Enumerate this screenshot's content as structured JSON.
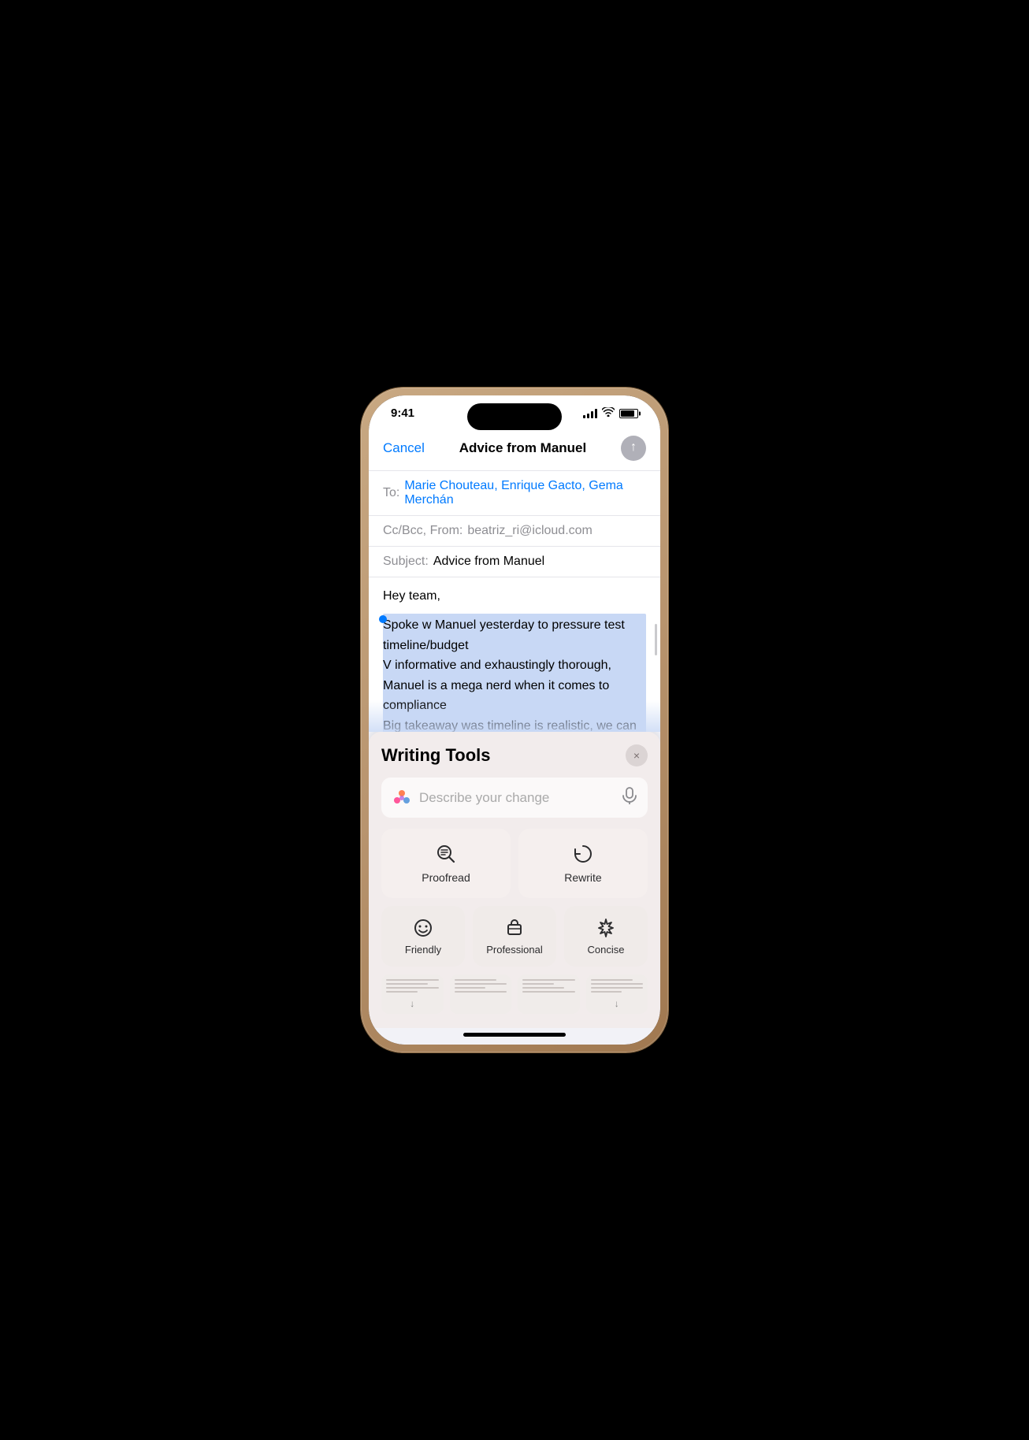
{
  "statusBar": {
    "time": "9:41",
    "batteryLevel": 85
  },
  "navBar": {
    "cancel": "Cancel",
    "title": "Advice from Manuel",
    "sendArrow": "↑"
  },
  "fields": {
    "toLabel": "To:",
    "toValue": "Marie Chouteau, Enrique Gacto, Gema Merchán",
    "ccBccLabel": "Cc/Bcc, From:",
    "ccBccValue": "beatriz_ri@icloud.com",
    "subjectLabel": "Subject:",
    "subjectValue": "Advice from Manuel"
  },
  "emailBody": {
    "greeting": "Hey team,",
    "selectedText": "Spoke w Manuel yesterday to pressure test timeline/budget\nV informative and exhaustingly thorough, Manuel is a mega nerd when it comes to compliance\nBig takeaway was timeline is realistic, we can commit with confidence, woo!\nM's firm specializes in community consultation, we need help here, should consider engaging them for comms/for our stakeholders"
  },
  "writingTools": {
    "title": "Writing Tools",
    "closeLabel": "×",
    "searchPlaceholder": "Describe your change",
    "tools": [
      {
        "id": "proofread",
        "label": "Proofread",
        "iconType": "proofread"
      },
      {
        "id": "rewrite",
        "label": "Rewrite",
        "iconType": "rewrite"
      }
    ],
    "toneTools": [
      {
        "id": "friendly",
        "label": "Friendly",
        "iconType": "smiley"
      },
      {
        "id": "professional",
        "label": "Professional",
        "iconType": "briefcase"
      },
      {
        "id": "concise",
        "label": "Concise",
        "iconType": "sparkle"
      }
    ],
    "thumbnails": [
      {
        "id": "thumb1",
        "hasArrowDown": true
      },
      {
        "id": "thumb2",
        "hasArrowDown": false
      },
      {
        "id": "thumb3",
        "hasArrowDown": false
      },
      {
        "id": "thumb4",
        "hasArrowDown": true
      }
    ]
  }
}
